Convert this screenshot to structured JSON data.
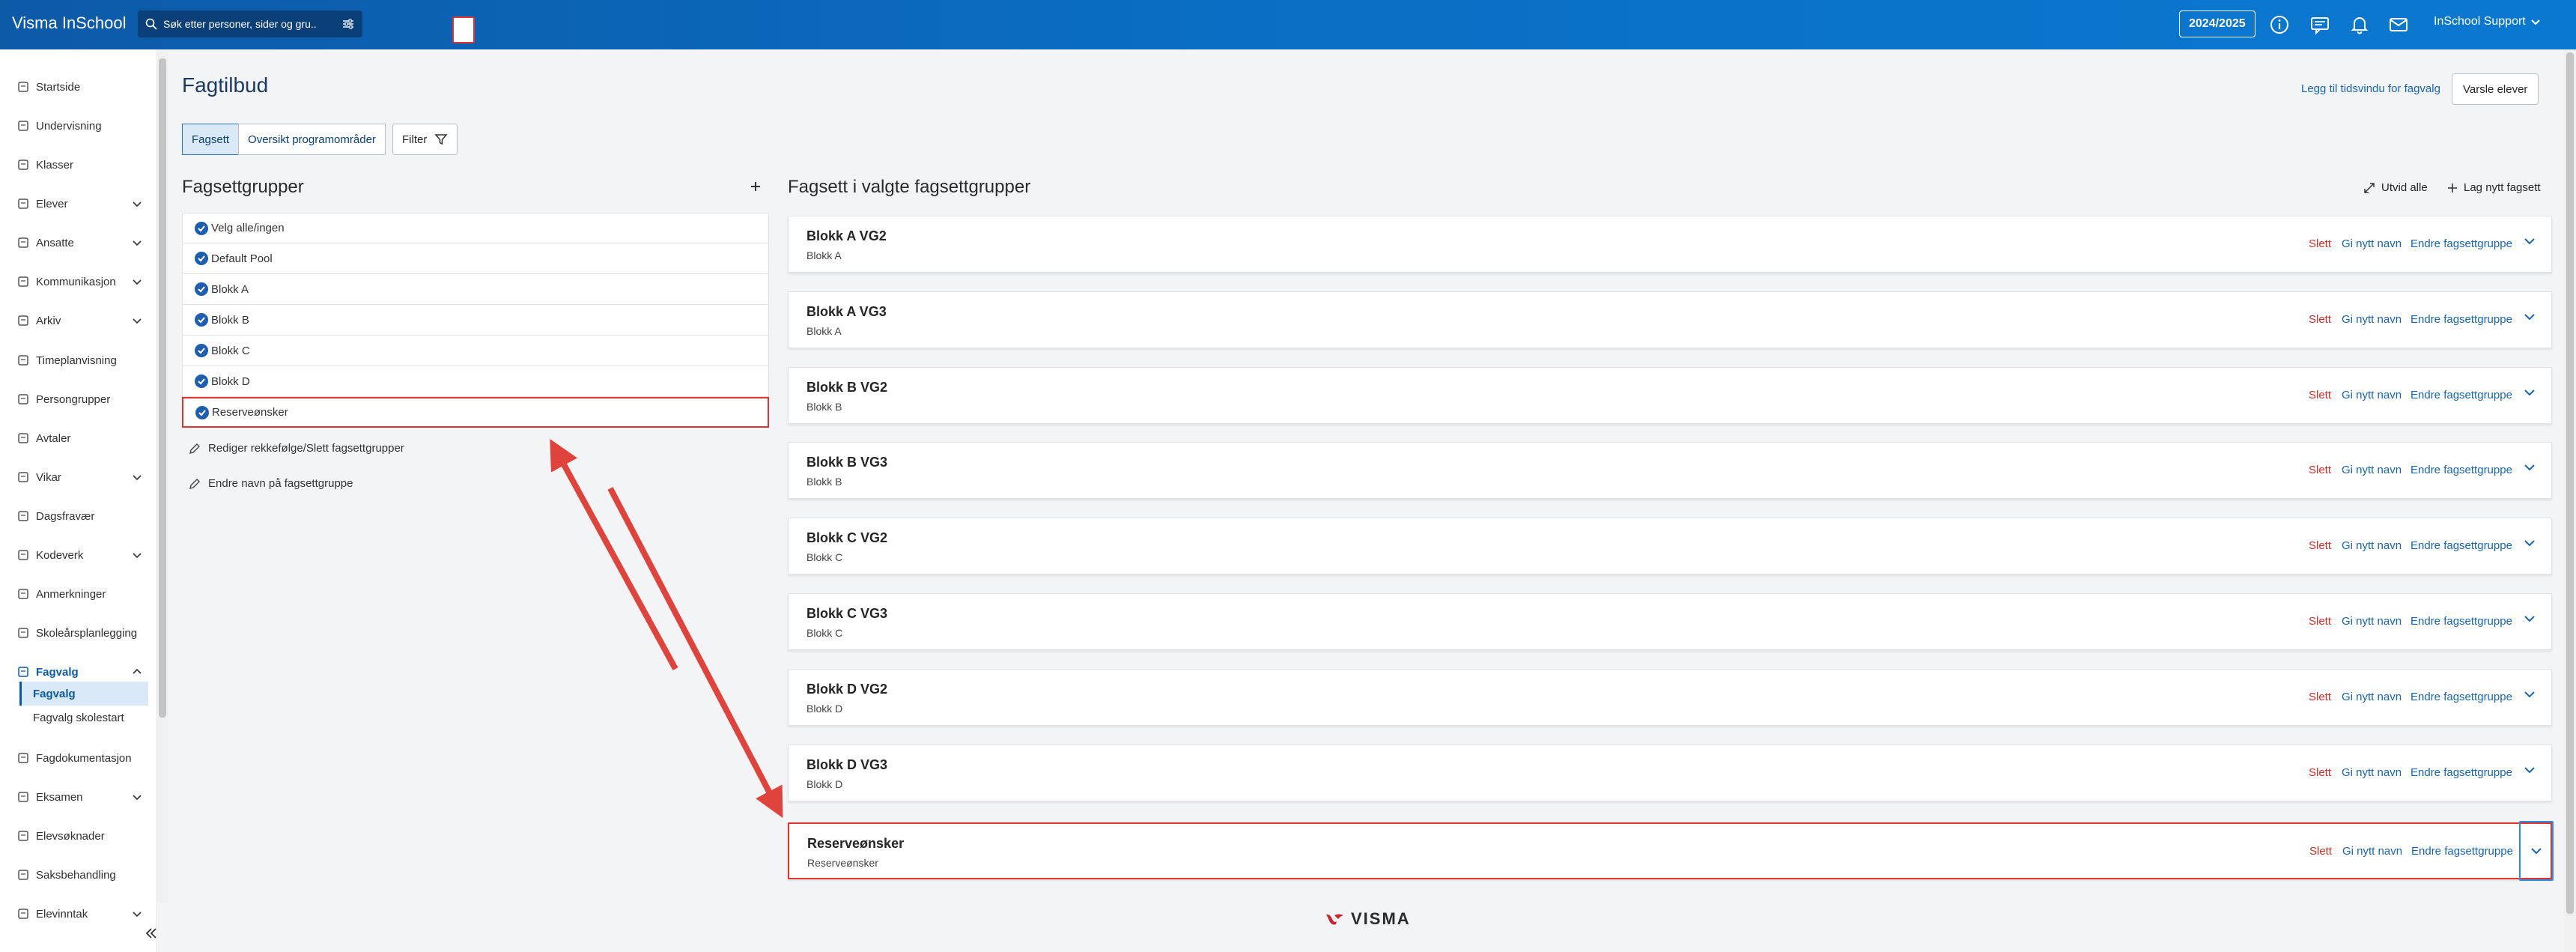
{
  "app": {
    "title": "Visma InSchool"
  },
  "search": {
    "placeholder": "Søk etter personer, sider og gru.."
  },
  "topbar": {
    "year": "2024/2025",
    "user": "InSchool Support"
  },
  "sidebar": {
    "items": [
      {
        "label": "Startside",
        "icon": "home-icon"
      },
      {
        "label": "Undervisning",
        "icon": "calendar-icon"
      },
      {
        "label": "Klasser",
        "icon": "class-icon"
      },
      {
        "label": "Elever",
        "icon": "student-icon"
      },
      {
        "label": "Ansatte",
        "icon": "staff-icon"
      },
      {
        "label": "Kommunikasjon",
        "icon": "chat-icon"
      },
      {
        "label": "Arkiv",
        "icon": "archive-icon"
      },
      {
        "label": "Timeplanvisning",
        "icon": "schedule-icon"
      },
      {
        "label": "Persongrupper",
        "icon": "group-icon"
      },
      {
        "label": "Avtaler",
        "icon": "agreement-icon"
      },
      {
        "label": "Vikar",
        "icon": "substitute-icon"
      },
      {
        "label": "Dagsfravær",
        "icon": "absence-icon"
      },
      {
        "label": "Kodeverk",
        "icon": "code-icon"
      },
      {
        "label": "Anmerkninger",
        "icon": "remark-icon"
      },
      {
        "label": "Skoleårsplanlegging",
        "icon": "planning-icon"
      },
      {
        "label": "Fagvalg",
        "icon": "subject-choice-icon"
      },
      {
        "label": "Fagdokumentasjon",
        "icon": "document-icon"
      },
      {
        "label": "Eksamen",
        "icon": "exam-icon"
      },
      {
        "label": "Elevsøknader",
        "icon": "application-icon"
      },
      {
        "label": "Saksbehandling",
        "icon": "folder-icon"
      },
      {
        "label": "Elevinntak",
        "icon": "intake-icon"
      }
    ],
    "sub": [
      "Fagvalg",
      "Fagvalg skolestart"
    ]
  },
  "page": {
    "title": "Fagtilbud",
    "add_window": "Legg til tidsvindu for fagvalg",
    "notify": "Varsle elever",
    "tabs": [
      "Fagsett",
      "Oversikt programområder"
    ],
    "filter": "Filter"
  },
  "groups": {
    "title": "Fagsettgrupper",
    "rows": [
      "Velg alle/ingen",
      "Default Pool",
      "Blokk A",
      "Blokk B",
      "Blokk C",
      "Blokk D",
      "Reserveønsker"
    ],
    "edit_order": "Rediger rekkefølge/Slett fagsettgrupper",
    "rename": "Endre navn på fagsettgruppe"
  },
  "sets": {
    "title": "Fagsett i valgte fagsettgrupper",
    "expand_all": "Utvid alle",
    "new_set": "Lag nytt fagsett",
    "delete": "Slett",
    "rename": "Gi nytt navn",
    "change_group": "Endre fagsettgruppe",
    "cards": [
      {
        "title": "Blokk A VG2",
        "sub": "Blokk A"
      },
      {
        "title": "Blokk A VG3",
        "sub": "Blokk A"
      },
      {
        "title": "Blokk B VG2",
        "sub": "Blokk B"
      },
      {
        "title": "Blokk B VG3",
        "sub": "Blokk B"
      },
      {
        "title": "Blokk C VG2",
        "sub": "Blokk C"
      },
      {
        "title": "Blokk C VG3",
        "sub": "Blokk C"
      },
      {
        "title": "Blokk D VG2",
        "sub": "Blokk D"
      },
      {
        "title": "Blokk D VG3",
        "sub": "Blokk D"
      },
      {
        "title": "Reserveønsker",
        "sub": "Reserveønsker"
      }
    ]
  },
  "footer": {
    "logo": "VISMA"
  },
  "colors": {
    "accent": "#0a6fc5",
    "danger": "#d32c24",
    "link": "#1765b5",
    "highlight": "#e0342f"
  }
}
